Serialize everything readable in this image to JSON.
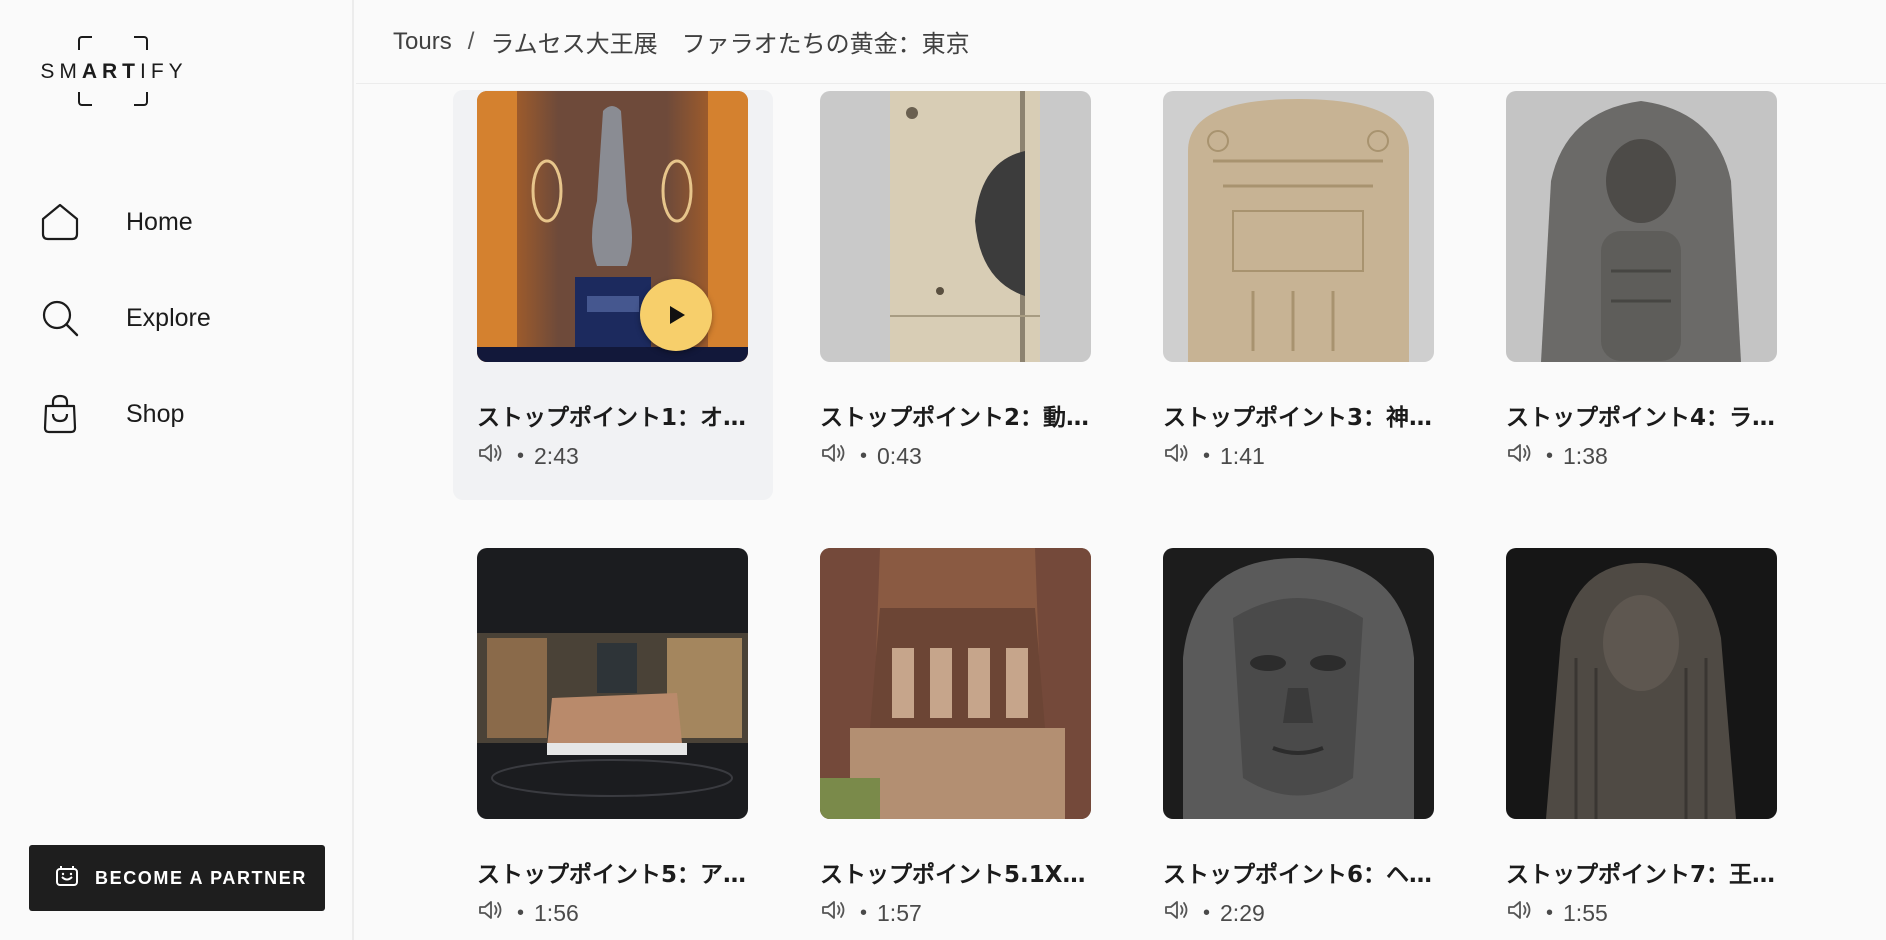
{
  "sidebar": {
    "logo": {
      "pre": "SM",
      "bold": "ART",
      "post": "IFY"
    },
    "nav": [
      {
        "label": "Home",
        "icon": "home-icon"
      },
      {
        "label": "Explore",
        "icon": "search-icon"
      },
      {
        "label": "Shop",
        "icon": "shopping-bag-icon"
      }
    ],
    "partner_button": {
      "label": "BECOME A PARTNER",
      "icon": "partner-icon"
    }
  },
  "header": {
    "breadcrumb_root": "Tours",
    "separator": "/",
    "breadcrumb_current": "ラムセス大王展　ファラオたちの黄金：東京"
  },
  "stops": [
    {
      "title": "ストップポイント1：オ…",
      "duration": "2:43",
      "playing": true
    },
    {
      "title": "ストップポイント2：動…",
      "duration": "0:43"
    },
    {
      "title": "ストップポイント3：神…",
      "duration": "1:41"
    },
    {
      "title": "ストップポイント4：ラ…",
      "duration": "1:38"
    },
    {
      "title": "ストップポイント5：ア…",
      "duration": "1:56"
    },
    {
      "title": "ストップポイント5.1X…",
      "duration": "1:57"
    },
    {
      "title": "ストップポイント6：ヘ…",
      "duration": "2:29"
    },
    {
      "title": "ストップポイント7：王…",
      "duration": "1:55"
    }
  ],
  "meta_separator": "•",
  "colors": {
    "play_button": "#f7cf6b",
    "partner_button_bg": "#1e1e1e",
    "active_card_bg": "#f1f2f4"
  }
}
